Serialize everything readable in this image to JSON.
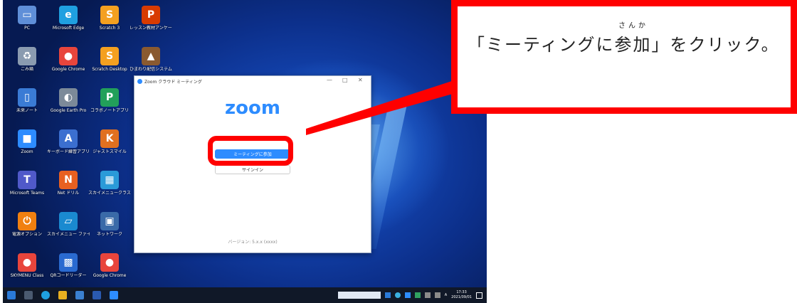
{
  "desktop": {
    "icons": [
      {
        "label": "PC",
        "color": "#5f8fd8",
        "glyph": "▭"
      },
      {
        "label": "Microsoft Edge",
        "color": "#1fa0e0",
        "glyph": "e"
      },
      {
        "label": "Scratch 3",
        "color": "#f4a020",
        "glyph": "S"
      },
      {
        "label": "レッスン教材アンケート",
        "color": "#d83b01",
        "glyph": "P"
      },
      {
        "label": "ごみ箱",
        "color": "#8a9bb0",
        "glyph": "♻"
      },
      {
        "label": "Google Chrome",
        "color": "#e8453c",
        "glyph": "●"
      },
      {
        "label": "Scratch Desktop",
        "color": "#f4a020",
        "glyph": "S"
      },
      {
        "label": "ひまわり配信システム",
        "color": "#8a5a30",
        "glyph": "▲"
      },
      {
        "label": "未来ノート",
        "color": "#3a7bd5",
        "glyph": "▯"
      },
      {
        "label": "Google Earth Pro",
        "color": "#7c8a99",
        "glyph": "◐"
      },
      {
        "label": "コラボノートアプリ",
        "color": "#22a05a",
        "glyph": "P"
      },
      {
        "label": "Zoom",
        "color": "#2d8cff",
        "glyph": "■"
      },
      {
        "label": "キーボード練習アプリ",
        "color": "#3b6fd0",
        "glyph": "A"
      },
      {
        "label": "ジャストスマイル",
        "color": "#e07020",
        "glyph": "K"
      },
      {
        "label": "Microsoft Teams",
        "color": "#5059c9",
        "glyph": "T"
      },
      {
        "label": "Net ドリル",
        "color": "#e86020",
        "glyph": "N"
      },
      {
        "label": "スカイメニュークラス",
        "color": "#2a9ad8",
        "glyph": "▦"
      },
      {
        "label": "電源オプション",
        "color": "#f08010",
        "glyph": "⏻"
      },
      {
        "label": "スカイメニュー ファイル",
        "color": "#1a8ad0",
        "glyph": "▱"
      },
      {
        "label": "ネットワーク",
        "color": "#3a6aa8",
        "glyph": "▣"
      },
      {
        "label": "SKYMENU Class",
        "color": "#e8453c",
        "glyph": "●"
      },
      {
        "label": "QRコードリーダー",
        "color": "#2a6ad0",
        "glyph": "▩"
      },
      {
        "label": "Google Chrome",
        "color": "#e8453c",
        "glyph": "●"
      }
    ]
  },
  "zoom_window": {
    "title": "Zoom クラウド ミーティング",
    "controls": [
      "—",
      "□",
      "✕"
    ],
    "logo": "zoom",
    "join_button": "ミーティングに参加",
    "signin_button": "サインイン",
    "version": "バージョン: 5.x.x (xxxx)"
  },
  "taskbar": {
    "clock_time": "17:33",
    "clock_date": "2021/09/01",
    "ime": "A"
  },
  "callout": {
    "furigana": "さんか",
    "text": "「ミーティングに参加」をクリック。"
  },
  "colors": {
    "accent": "#ff0000",
    "zoom_blue": "#2d8cff"
  }
}
